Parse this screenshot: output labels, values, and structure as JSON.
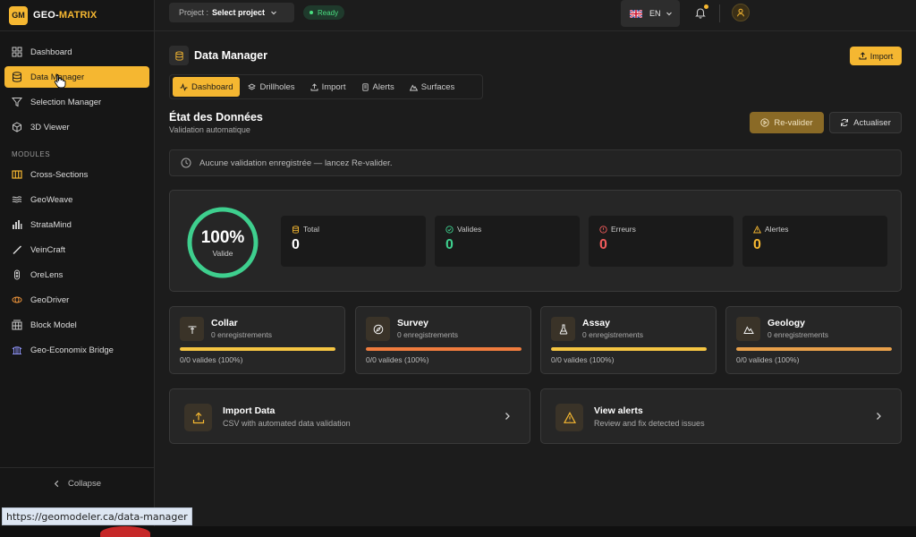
{
  "app": {
    "logo_badge": "GM",
    "logo_main": "GEO-",
    "logo_accent": "MATRIX"
  },
  "sidebar": {
    "items": [
      {
        "label": "Dashboard",
        "icon": "grid-icon"
      },
      {
        "label": "Data Manager",
        "icon": "database-icon",
        "active": true
      },
      {
        "label": "Selection Manager",
        "icon": "filter-icon"
      },
      {
        "label": "3D Viewer",
        "icon": "cube-icon"
      }
    ],
    "section": "MODULES",
    "modules": [
      {
        "label": "Cross-Sections",
        "icon": "cross-sections-icon"
      },
      {
        "label": "GeoWeave",
        "icon": "geoweave-icon"
      },
      {
        "label": "StrataMind",
        "icon": "stratamind-icon"
      },
      {
        "label": "VeinCraft",
        "icon": "veincraft-icon"
      },
      {
        "label": "OreLens",
        "icon": "orelens-icon"
      },
      {
        "label": "GeoDriver",
        "icon": "geodriver-icon"
      },
      {
        "label": "Block Model",
        "icon": "block-model-icon"
      },
      {
        "label": "Geo-Economix Bridge",
        "icon": "bridge-icon"
      }
    ],
    "collapse": "Collapse"
  },
  "topbar": {
    "project_label": "Project :",
    "project_value": "Select project",
    "status": "Ready",
    "language": "EN"
  },
  "page": {
    "title": "Data Manager",
    "import_button": "Import",
    "tabs": [
      {
        "label": "Dashboard",
        "active": true
      },
      {
        "label": "Drillholes"
      },
      {
        "label": "Import"
      },
      {
        "label": "Alerts"
      },
      {
        "label": "Surfaces"
      }
    ],
    "section_title": "État des Données",
    "section_subtitle": "Validation automatique",
    "revalidate_button": "Re-valider",
    "refresh_button": "Actualiser",
    "notice": "Aucune validation enregistrée — lancez Re-valider."
  },
  "summary": {
    "percent": "100%",
    "percent_value": 1.0,
    "percent_label": "Valide",
    "stats": [
      {
        "label": "Total",
        "value": "0",
        "color": "#ffffff"
      },
      {
        "label": "Valides",
        "value": "0",
        "color": "#3ecf8e"
      },
      {
        "label": "Erreurs",
        "value": "0",
        "color": "#f25c5c"
      },
      {
        "label": "Alertes",
        "value": "0",
        "color": "#f5b731"
      }
    ]
  },
  "tables": [
    {
      "title": "Collar",
      "subtitle": "0 enregistrements",
      "footer": "0/0 valides (100%)",
      "fill": 1.0,
      "bar_color": "#f5c542"
    },
    {
      "title": "Survey",
      "subtitle": "0 enregistrements",
      "footer": "0/0 valides (100%)",
      "fill": 1.0,
      "bar_color": "#f07c3e"
    },
    {
      "title": "Assay",
      "subtitle": "0 enregistrements",
      "footer": "0/0 valides (100%)",
      "fill": 1.0,
      "bar_color": "#f5c542"
    },
    {
      "title": "Geology",
      "subtitle": "0 enregistrements",
      "footer": "0/0 valides (100%)",
      "fill": 1.0,
      "bar_color": "#e8a04a"
    }
  ],
  "actions": [
    {
      "title": "Import Data",
      "subtitle": "CSV with automated data validation"
    },
    {
      "title": "View alerts",
      "subtitle": "Review and fix detected issues"
    }
  ],
  "status_bar": {
    "url": "https://geomodeler.ca/data-manager"
  },
  "colors": {
    "accent": "#f5b731",
    "success": "#3ecf8e",
    "error": "#f25c5c",
    "background": "#1c1c1c"
  }
}
